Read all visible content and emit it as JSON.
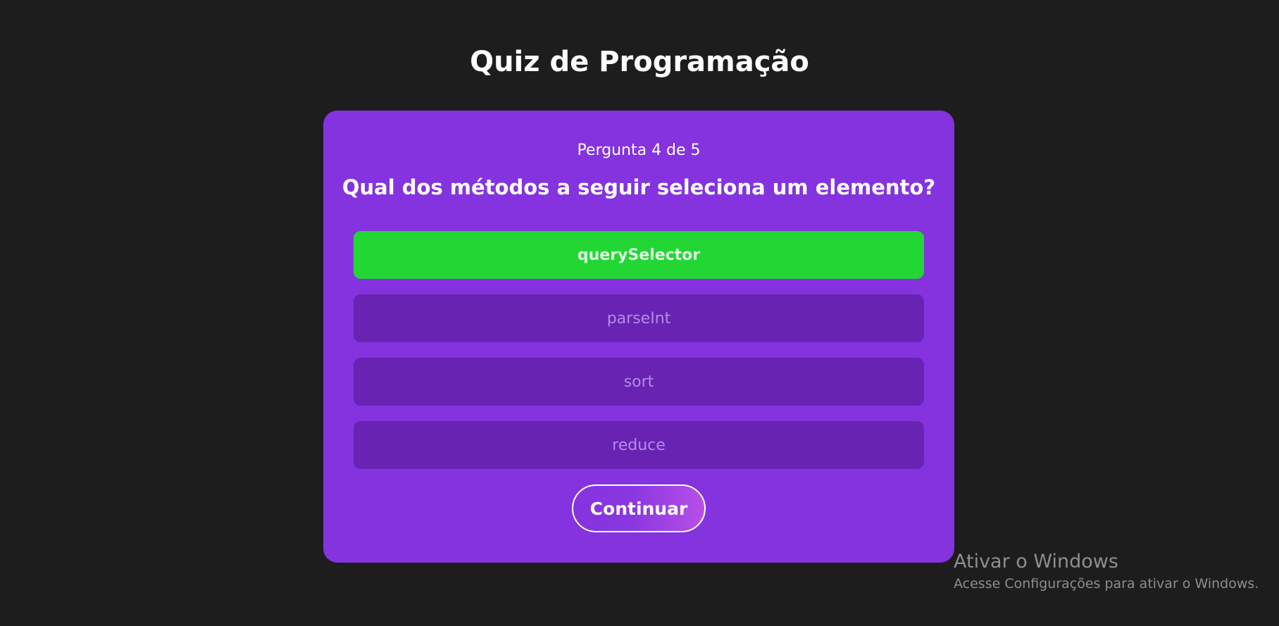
{
  "page": {
    "title": "Quiz de Programação"
  },
  "quiz": {
    "counter": "Pergunta 4 de 5",
    "question": "Qual dos métodos a seguir seleciona um elemento?",
    "answers": [
      {
        "label": "querySelector",
        "state": "correct"
      },
      {
        "label": "parseInt",
        "state": "disabled"
      },
      {
        "label": "sort",
        "state": "disabled"
      },
      {
        "label": "reduce",
        "state": "disabled"
      }
    ],
    "continue_label": "Continuar"
  },
  "watermark": {
    "title": "Ativar o Windows",
    "subtitle": "Acesse Configurações para ativar o Windows."
  },
  "colors": {
    "background": "#1d1d1d",
    "card": "#8433df",
    "answer_default": "#6823b3",
    "answer_correct": "#22d633"
  }
}
